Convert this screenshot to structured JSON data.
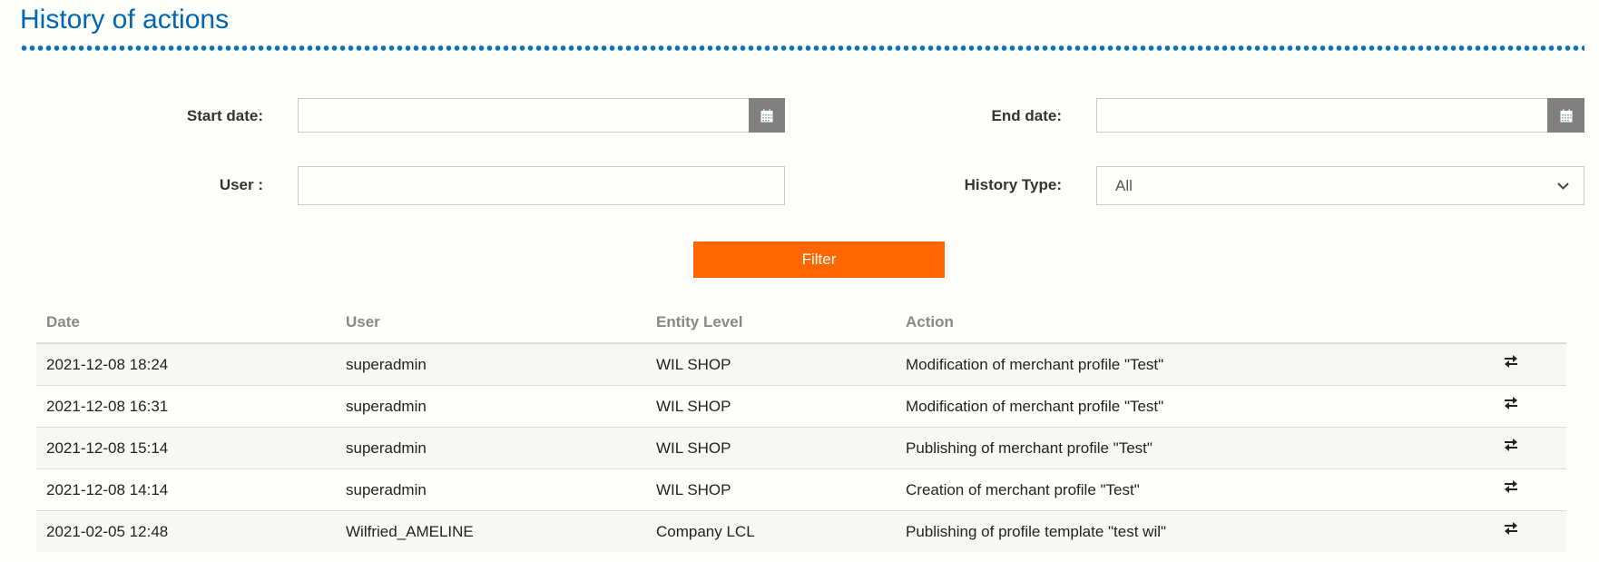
{
  "header": {
    "title": "History of actions"
  },
  "filters": {
    "start_date": {
      "label": "Start date:",
      "value": "",
      "placeholder": ""
    },
    "end_date": {
      "label": "End date:",
      "value": "",
      "placeholder": ""
    },
    "user": {
      "label": "User :",
      "value": "",
      "placeholder": ""
    },
    "history_type": {
      "label": "History Type:",
      "selected": "All"
    },
    "calendar_icon": "calendar-icon",
    "filter_button": "Filter"
  },
  "colors": {
    "title": "#0066b3",
    "filter_button": "#ff6600",
    "calendar_button": "#808080"
  },
  "table": {
    "columns": [
      "Date",
      "User",
      "Entity Level",
      "Action"
    ],
    "row_icon": "swap-arrows-icon",
    "rows": [
      {
        "date": "2021-12-08 18:24",
        "user": "superadmin",
        "entity": "WIL SHOP",
        "action": "Modification of merchant profile \"Test\""
      },
      {
        "date": "2021-12-08 16:31",
        "user": "superadmin",
        "entity": "WIL SHOP",
        "action": "Modification of merchant profile \"Test\""
      },
      {
        "date": "2021-12-08 15:14",
        "user": "superadmin",
        "entity": "WIL SHOP",
        "action": "Publishing of merchant profile \"Test\""
      },
      {
        "date": "2021-12-08 14:14",
        "user": "superadmin",
        "entity": "WIL SHOP",
        "action": "Creation of merchant profile \"Test\""
      },
      {
        "date": "2021-02-05 12:48",
        "user": "Wilfried_AMELINE",
        "entity": "Company LCL",
        "action": "Publishing of profile template \"test wil\""
      }
    ]
  }
}
